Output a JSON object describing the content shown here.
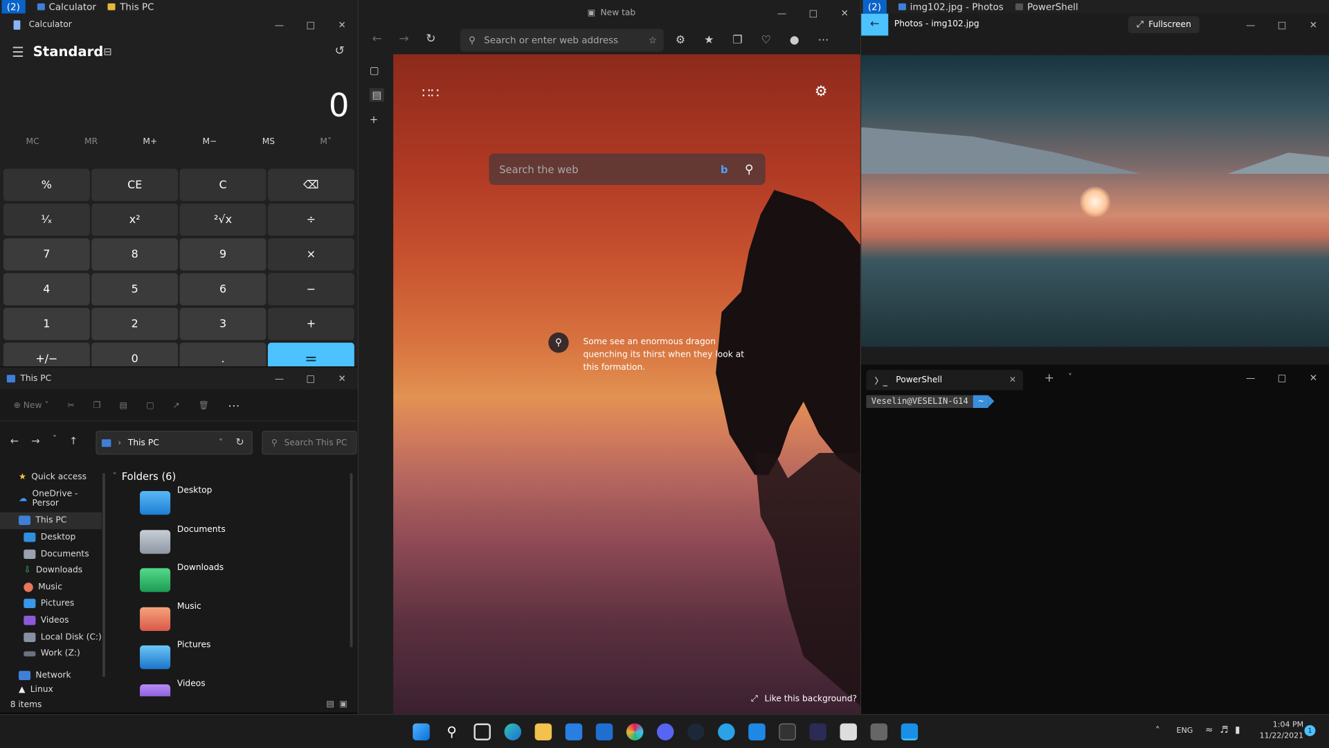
{
  "top_bar_left": {
    "zone_count": "(2)",
    "apps": [
      "Calculator",
      "This PC"
    ]
  },
  "top_bar_right": {
    "zone_count": "(2)",
    "apps": [
      "img102.jpg - Photos",
      "PowerShell"
    ]
  },
  "calculator": {
    "title": "Calculator",
    "mode": "Standard",
    "display": "0",
    "memory": [
      "MC",
      "MR",
      "M+",
      "M−",
      "MS",
      "M˅"
    ],
    "keys": [
      "%",
      "CE",
      "C",
      "⌫",
      "¹⁄ₓ",
      "x²",
      "²√x",
      "÷",
      "7",
      "8",
      "9",
      "×",
      "4",
      "5",
      "6",
      "−",
      "1",
      "2",
      "3",
      "+",
      "+/−",
      "0",
      ".",
      "="
    ]
  },
  "explorer": {
    "title": "This PC",
    "new_label": "New",
    "address": "This PC",
    "search_placeholder": "Search This PC",
    "nav": [
      "Quick access",
      "OneDrive - Persor",
      "This PC",
      "Desktop",
      "Documents",
      "Downloads",
      "Music",
      "Pictures",
      "Videos",
      "Local Disk (C:)",
      "Work (Z:)",
      "Network",
      "Linux"
    ],
    "folders_header": "Folders (6)",
    "folders": [
      "Desktop",
      "Documents",
      "Downloads",
      "Music",
      "Pictures",
      "Videos"
    ],
    "status": "8 items"
  },
  "edge": {
    "tab_title": "New tab",
    "address_placeholder": "Search or enter web address",
    "search_placeholder": "Search the web",
    "caption": "Some see an enormous dragon quenching its thirst when they look at this formation.",
    "like_bg": "Like this background?"
  },
  "photos": {
    "title": "Photos - img102.jpg",
    "fullscreen": "Fullscreen"
  },
  "powershell": {
    "tab": "PowerShell",
    "prompt": "Veselin@VESELIN-G14",
    "prompt_tail": "~"
  },
  "tray": {
    "lang": "ENG",
    "time": "1:04 PM",
    "date": "11/22/2021",
    "badge": "1"
  },
  "colors": {
    "accent": "#4cc2ff",
    "zone": "#0a63c9"
  }
}
